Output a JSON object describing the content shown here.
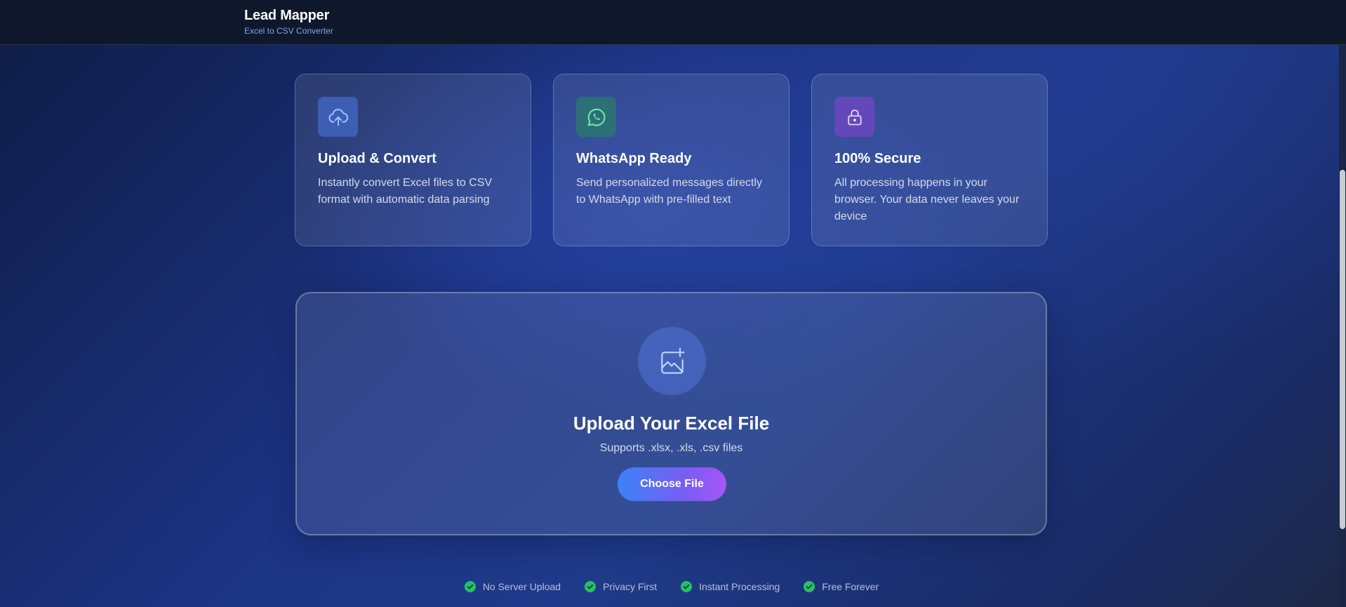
{
  "header": {
    "title": "Lead Mapper",
    "subtitle": "Excel to CSV Converter"
  },
  "features": [
    {
      "icon": "cloud-upload-icon",
      "title": "Upload & Convert",
      "description": "Instantly convert Excel files to CSV format with automatic data parsing",
      "accent": "#4a78e6"
    },
    {
      "icon": "whatsapp-icon",
      "title": "WhatsApp Ready",
      "description": "Send personalized messages directly to WhatsApp with pre-filled text",
      "accent": "#4ade80"
    },
    {
      "icon": "lock-icon",
      "title": "100% Secure",
      "description": "All processing happens in your browser. Your data never leaves your device",
      "accent": "#a78bfa"
    }
  ],
  "upload": {
    "icon": "image-add-icon",
    "title": "Upload Your Excel File",
    "subtitle": "Supports .xlsx, .xls, .csv files",
    "button_label": "Choose File"
  },
  "badges": [
    {
      "icon": "check-circle-icon",
      "label": "No Server Upload"
    },
    {
      "icon": "check-circle-icon",
      "label": "Privacy First"
    },
    {
      "icon": "check-circle-icon",
      "label": "Instant Processing"
    },
    {
      "icon": "check-circle-icon",
      "label": "Free Forever"
    }
  ],
  "colors": {
    "header_bg": "#0f172a",
    "page_bg": "#1e3a8a",
    "check_green": "#22c55e",
    "button_gradient_start": "#3b82f6",
    "button_gradient_end": "#a855f7"
  }
}
